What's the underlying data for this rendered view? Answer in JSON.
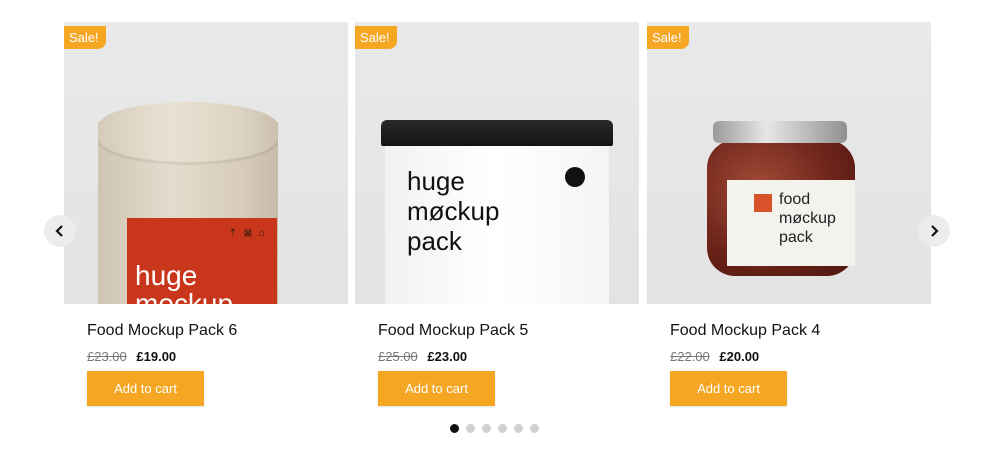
{
  "badges": {
    "sale": "Sale!"
  },
  "products": [
    {
      "title": "Food Mockup Pack 6",
      "old_price": "£23.00",
      "price": "£19.00",
      "button": "Add to cart",
      "image_text": "huge\nmockup",
      "icons_text": "⇡ ⊠ ⌂"
    },
    {
      "title": "Food Mockup Pack 5",
      "old_price": "£25.00",
      "price": "£23.00",
      "button": "Add to cart",
      "image_text": "huge\nmøckup\npack"
    },
    {
      "title": "Food Mockup Pack 4",
      "old_price": "£22.00",
      "price": "£20.00",
      "button": "Add to cart",
      "image_text": "food\nmøckup\npack"
    }
  ],
  "navigation": {
    "prev_icon": "chevron-left-icon",
    "next_icon": "chevron-right-icon",
    "dot_count": 6,
    "active_dot": 1
  },
  "colors": {
    "accent": "#f5a623",
    "dot_active": "#111111",
    "dot_inactive": "#d0d0d0"
  }
}
